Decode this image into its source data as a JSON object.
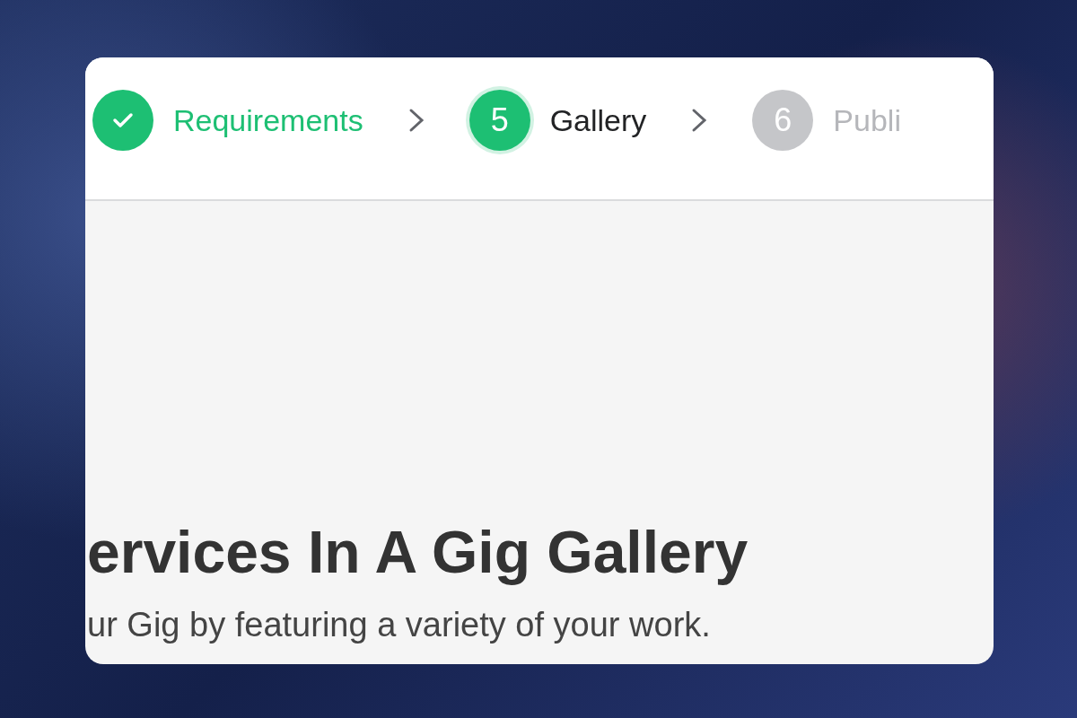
{
  "steps": [
    {
      "label": "Requirements",
      "completed": true,
      "selected": false
    },
    {
      "number": "5",
      "label": "Gallery",
      "completed": false,
      "selected": true
    },
    {
      "number": "6",
      "label": "Publi",
      "completed": false,
      "selected": false
    }
  ],
  "heading": "ervices In A Gig Gallery",
  "description": "ur Gig by featuring a variety of your work."
}
